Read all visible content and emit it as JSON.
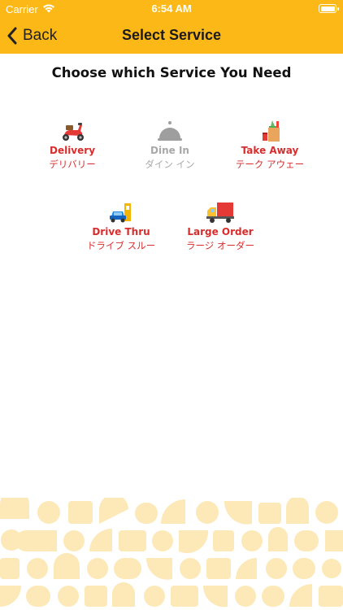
{
  "status_bar": {
    "carrier": "Carrier",
    "time": "6:54 AM"
  },
  "nav": {
    "back_label": "Back",
    "title": "Select Service"
  },
  "heading": "Choose which Service You Need",
  "services": [
    {
      "id": "delivery",
      "en": "Delivery",
      "jp": "デリバリー",
      "icon": "scooter-icon",
      "enabled": true
    },
    {
      "id": "dine-in",
      "en": "Dine In",
      "jp": "ダイン イン",
      "icon": "cloche-icon",
      "enabled": false
    },
    {
      "id": "take-away",
      "en": "Take Away",
      "jp": "テーク アウェー",
      "icon": "grocery-bag-icon",
      "enabled": true
    },
    {
      "id": "drive-thru",
      "en": "Drive Thru",
      "jp": "ドライブ スルー",
      "icon": "drive-thru-car-icon",
      "enabled": true
    },
    {
      "id": "large-order",
      "en": "Large Order",
      "jp": "ラージ オーダー",
      "icon": "delivery-truck-icon",
      "enabled": true
    }
  ],
  "colors": {
    "brand_yellow": "#FCB817",
    "accent_red": "#D72D2D",
    "disabled_gray": "#A8A8A8",
    "pattern": "#FCE9B7"
  }
}
